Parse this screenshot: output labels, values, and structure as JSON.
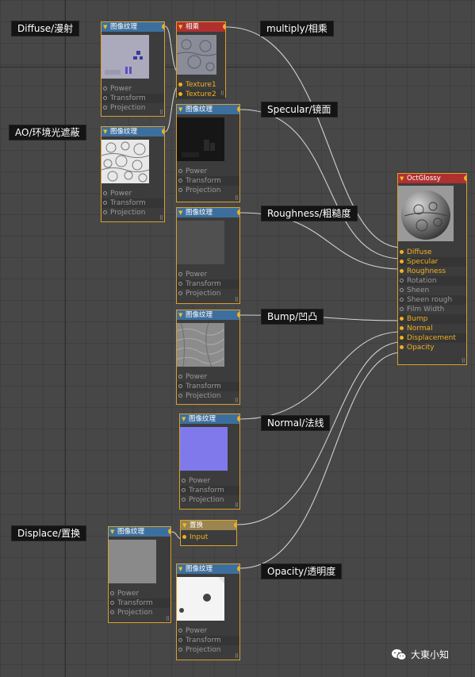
{
  "labels": {
    "diffuse": "Diffuse/漫射",
    "ao": "AO/环境光遮蔽",
    "multiply": "multiply/相乘",
    "specular": "Specular/镜面",
    "roughness": "Roughness/粗糙度",
    "bump": "Bump/凹凸",
    "normal": "Normal/法线",
    "displace": "Displace/置换",
    "opacity": "Opacity/透明度"
  },
  "image_node": {
    "title": "图像纹理",
    "ports": [
      "Power",
      "Transform",
      "Projection"
    ]
  },
  "multiply_node": {
    "title": "相乘",
    "ports": [
      "Texture1",
      "Texture2"
    ]
  },
  "displace_node": {
    "title": "置换",
    "ports": [
      "Input"
    ]
  },
  "material_node": {
    "title": "OctGlossy",
    "ports": [
      "Diffuse",
      "Specular",
      "Roughness",
      "Rotation",
      "Sheen",
      "Sheen rough",
      "Film Width",
      "Bump",
      "Normal",
      "Displacement",
      "Opacity"
    ]
  },
  "watermark": "大東小知",
  "colors": {
    "node_border": "#d9a030",
    "texture_header": "#3d6f9e",
    "material_header": "#b03030",
    "port_active": "#f0b020",
    "normal_map": "#7b73e8"
  }
}
